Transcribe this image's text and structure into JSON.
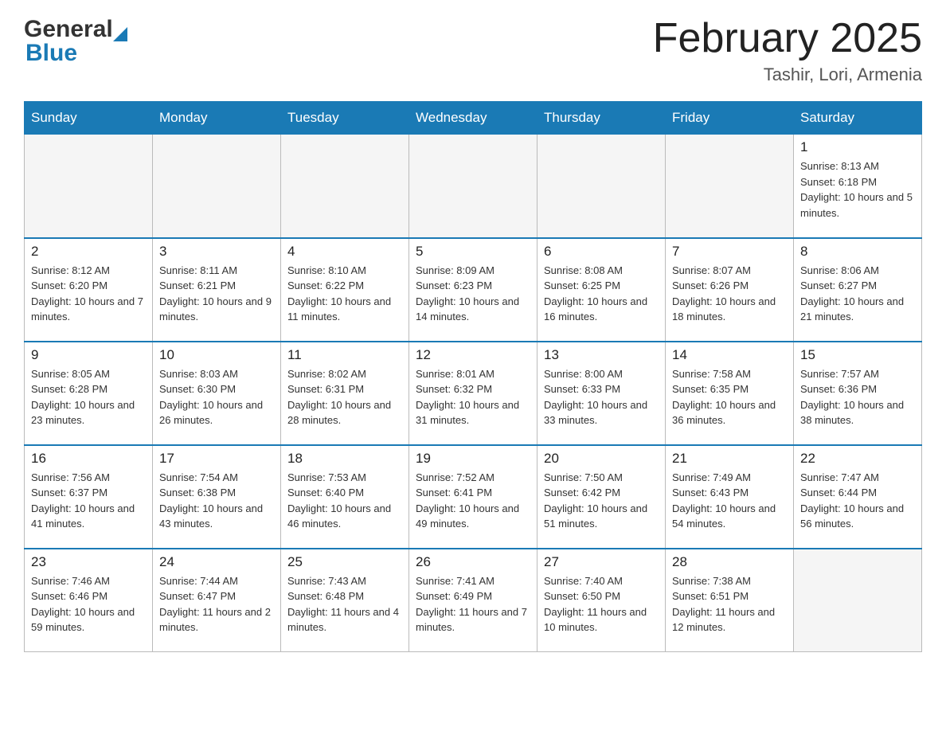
{
  "header": {
    "month_title": "February 2025",
    "location": "Tashir, Lori, Armenia",
    "logo_general": "General",
    "logo_blue": "Blue"
  },
  "weekdays": [
    "Sunday",
    "Monday",
    "Tuesday",
    "Wednesday",
    "Thursday",
    "Friday",
    "Saturday"
  ],
  "weeks": [
    [
      {
        "day": "",
        "empty": true
      },
      {
        "day": "",
        "empty": true
      },
      {
        "day": "",
        "empty": true
      },
      {
        "day": "",
        "empty": true
      },
      {
        "day": "",
        "empty": true
      },
      {
        "day": "",
        "empty": true
      },
      {
        "day": "1",
        "sunrise": "8:13 AM",
        "sunset": "6:18 PM",
        "daylight": "10 hours and 5 minutes."
      }
    ],
    [
      {
        "day": "2",
        "sunrise": "8:12 AM",
        "sunset": "6:20 PM",
        "daylight": "10 hours and 7 minutes."
      },
      {
        "day": "3",
        "sunrise": "8:11 AM",
        "sunset": "6:21 PM",
        "daylight": "10 hours and 9 minutes."
      },
      {
        "day": "4",
        "sunrise": "8:10 AM",
        "sunset": "6:22 PM",
        "daylight": "10 hours and 11 minutes."
      },
      {
        "day": "5",
        "sunrise": "8:09 AM",
        "sunset": "6:23 PM",
        "daylight": "10 hours and 14 minutes."
      },
      {
        "day": "6",
        "sunrise": "8:08 AM",
        "sunset": "6:25 PM",
        "daylight": "10 hours and 16 minutes."
      },
      {
        "day": "7",
        "sunrise": "8:07 AM",
        "sunset": "6:26 PM",
        "daylight": "10 hours and 18 minutes."
      },
      {
        "day": "8",
        "sunrise": "8:06 AM",
        "sunset": "6:27 PM",
        "daylight": "10 hours and 21 minutes."
      }
    ],
    [
      {
        "day": "9",
        "sunrise": "8:05 AM",
        "sunset": "6:28 PM",
        "daylight": "10 hours and 23 minutes."
      },
      {
        "day": "10",
        "sunrise": "8:03 AM",
        "sunset": "6:30 PM",
        "daylight": "10 hours and 26 minutes."
      },
      {
        "day": "11",
        "sunrise": "8:02 AM",
        "sunset": "6:31 PM",
        "daylight": "10 hours and 28 minutes."
      },
      {
        "day": "12",
        "sunrise": "8:01 AM",
        "sunset": "6:32 PM",
        "daylight": "10 hours and 31 minutes."
      },
      {
        "day": "13",
        "sunrise": "8:00 AM",
        "sunset": "6:33 PM",
        "daylight": "10 hours and 33 minutes."
      },
      {
        "day": "14",
        "sunrise": "7:58 AM",
        "sunset": "6:35 PM",
        "daylight": "10 hours and 36 minutes."
      },
      {
        "day": "15",
        "sunrise": "7:57 AM",
        "sunset": "6:36 PM",
        "daylight": "10 hours and 38 minutes."
      }
    ],
    [
      {
        "day": "16",
        "sunrise": "7:56 AM",
        "sunset": "6:37 PM",
        "daylight": "10 hours and 41 minutes."
      },
      {
        "day": "17",
        "sunrise": "7:54 AM",
        "sunset": "6:38 PM",
        "daylight": "10 hours and 43 minutes."
      },
      {
        "day": "18",
        "sunrise": "7:53 AM",
        "sunset": "6:40 PM",
        "daylight": "10 hours and 46 minutes."
      },
      {
        "day": "19",
        "sunrise": "7:52 AM",
        "sunset": "6:41 PM",
        "daylight": "10 hours and 49 minutes."
      },
      {
        "day": "20",
        "sunrise": "7:50 AM",
        "sunset": "6:42 PM",
        "daylight": "10 hours and 51 minutes."
      },
      {
        "day": "21",
        "sunrise": "7:49 AM",
        "sunset": "6:43 PM",
        "daylight": "10 hours and 54 minutes."
      },
      {
        "day": "22",
        "sunrise": "7:47 AM",
        "sunset": "6:44 PM",
        "daylight": "10 hours and 56 minutes."
      }
    ],
    [
      {
        "day": "23",
        "sunrise": "7:46 AM",
        "sunset": "6:46 PM",
        "daylight": "10 hours and 59 minutes."
      },
      {
        "day": "24",
        "sunrise": "7:44 AM",
        "sunset": "6:47 PM",
        "daylight": "11 hours and 2 minutes."
      },
      {
        "day": "25",
        "sunrise": "7:43 AM",
        "sunset": "6:48 PM",
        "daylight": "11 hours and 4 minutes."
      },
      {
        "day": "26",
        "sunrise": "7:41 AM",
        "sunset": "6:49 PM",
        "daylight": "11 hours and 7 minutes."
      },
      {
        "day": "27",
        "sunrise": "7:40 AM",
        "sunset": "6:50 PM",
        "daylight": "11 hours and 10 minutes."
      },
      {
        "day": "28",
        "sunrise": "7:38 AM",
        "sunset": "6:51 PM",
        "daylight": "11 hours and 12 minutes."
      },
      {
        "day": "",
        "empty": true
      }
    ]
  ]
}
